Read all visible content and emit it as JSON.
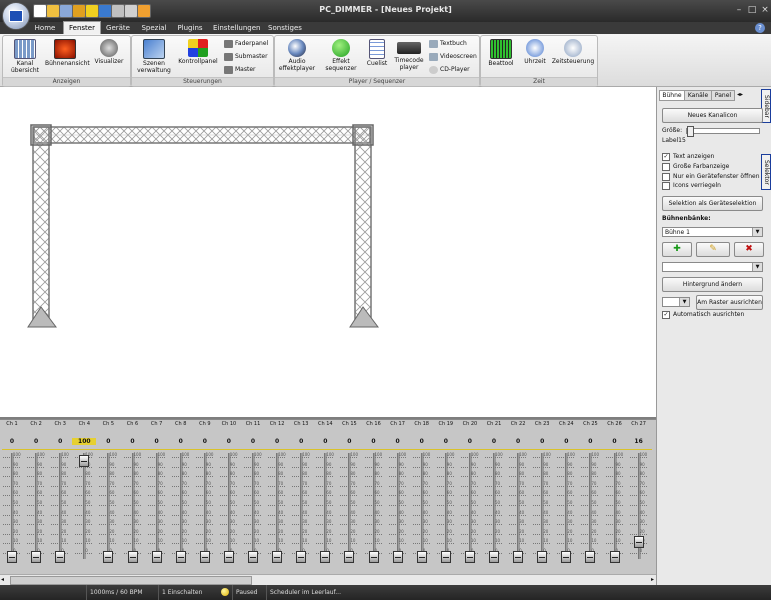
{
  "window": {
    "title": "PC_DIMMER - [Neues Projekt]"
  },
  "tabs": [
    {
      "label": "Home"
    },
    {
      "label": "Fenster",
      "active": true
    },
    {
      "label": "Geräte"
    },
    {
      "label": "Spezial"
    },
    {
      "label": "Plugins"
    },
    {
      "label": "Einstellungen"
    },
    {
      "label": "Sonstiges"
    }
  ],
  "ribbon": {
    "anzeigen": {
      "label": "Anzeigen",
      "kanal": "Kanal übersicht",
      "buehne": "Bühnenansicht",
      "visualizer": "Visualizer"
    },
    "steuerungen": {
      "label": "Steuerungen",
      "szenen": "Szenen verwaltung",
      "kontroll": "Kontrollpanel",
      "fader": "Faderpanel",
      "submaster": "Submaster",
      "master": "Master"
    },
    "player": {
      "label": "Player / Sequenzer",
      "audio": "Audio effektplayer",
      "effekt": "Effekt sequenzer",
      "cuelist": "Cuelist",
      "timecode": "Timecode player",
      "textbuch": "Textbuch",
      "video": "Videoscreen",
      "cd": "CD-Player"
    },
    "zeit": {
      "label": "Zeit",
      "beat": "Beattool",
      "uhr": "Uhrzeit",
      "zeitst": "Zeitsteuerung"
    }
  },
  "sidebar": {
    "tabs": [
      "Bühne",
      "Kanäle",
      "Panel"
    ],
    "neues_kanalicon": "Neues Kanalicon",
    "groesse_label": "Größe:",
    "label15": "Label15",
    "checks": [
      {
        "label": "Text anzeigen",
        "checked": true
      },
      {
        "label": "Große Farbanzeige",
        "checked": false
      },
      {
        "label": "Nur ein Gerätefenster öffnen",
        "checked": false
      },
      {
        "label": "Icons verriegeln",
        "checked": false
      }
    ],
    "selektion_btn": "Selektion als Geräteselektion",
    "buehnenbaenke_label": "Bühnenbänke:",
    "buehne_select": "Bühne 1",
    "hintergrund_btn": "Hintergrund ändern",
    "raster_btn": "Am Raster ausrichten",
    "auto_check": {
      "label": "Automatisch ausrichten",
      "checked": true
    },
    "side_tab_1": "Sidebar",
    "side_tab_2": "Selektor"
  },
  "channels": {
    "labels": [
      "Ch 1",
      "Ch 2",
      "Ch 3",
      "Ch 4",
      "Ch 5",
      "Ch 6",
      "Ch 7",
      "Ch 8",
      "Ch 9",
      "Ch 10",
      "Ch 11",
      "Ch 12",
      "Ch 13",
      "Ch 14",
      "Ch 15",
      "Ch 16",
      "Ch 17",
      "Ch 18",
      "Ch 19",
      "Ch 20",
      "Ch 21",
      "Ch 22",
      "Ch 23",
      "Ch 24",
      "Ch 25",
      "Ch 26",
      "Ch 27"
    ],
    "values": [
      "0",
      "0",
      "0",
      "100",
      "0",
      "0",
      "0",
      "0",
      "0",
      "0",
      "0",
      "0",
      "0",
      "0",
      "0",
      "0",
      "0",
      "0",
      "0",
      "0",
      "0",
      "0",
      "0",
      "0",
      "0",
      "0",
      "16"
    ],
    "levels": [
      0,
      0,
      0,
      1.0,
      0,
      0,
      0,
      0,
      0,
      0,
      0,
      0,
      0,
      0,
      0,
      0,
      0,
      0,
      0,
      0,
      0,
      0,
      0,
      0,
      0,
      0,
      0.16
    ],
    "ticks": [
      "100",
      "90",
      "80",
      "70",
      "60",
      "50",
      "40",
      "30",
      "20",
      "10",
      "0"
    ]
  },
  "status": {
    "timing": "1000ms / 60 BPM",
    "einschalten": "1 Einschalten",
    "paused": "Paused",
    "scheduler": "Scheduler im Leerlauf..."
  }
}
